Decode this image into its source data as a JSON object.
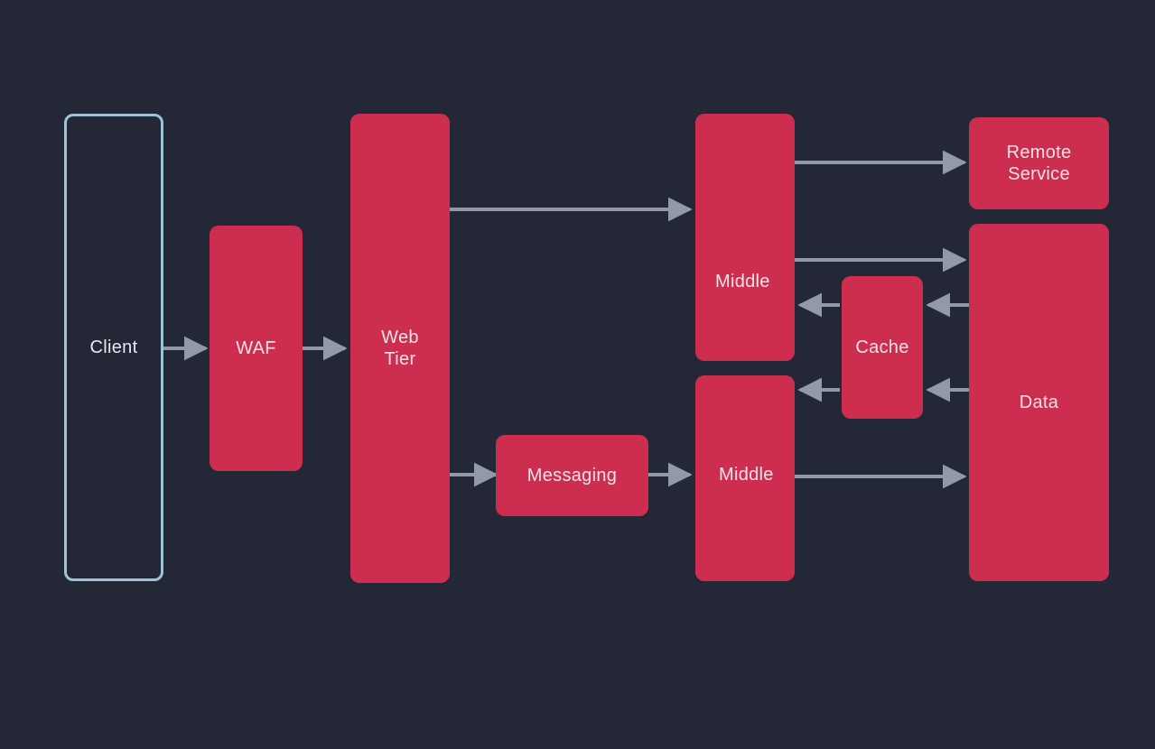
{
  "nodes": {
    "client": {
      "label": "Client"
    },
    "waf": {
      "label": "WAF"
    },
    "web_tier": {
      "label": "Web\nTier"
    },
    "messaging": {
      "label": "Messaging"
    },
    "middle_top": {
      "label": "Middle"
    },
    "middle_bottom": {
      "label": "Middle"
    },
    "cache": {
      "label": "Cache"
    },
    "remote": {
      "label": "Remote\nService"
    },
    "data": {
      "label": "Data"
    }
  },
  "colors": {
    "bg": "#242836",
    "node": "#cd2d4e",
    "outline": "#9bc4d6",
    "arrow": "#939aa7"
  },
  "edges": [
    {
      "from": "client",
      "to": "waf"
    },
    {
      "from": "waf",
      "to": "web_tier"
    },
    {
      "from": "web_tier",
      "to": "middle_top"
    },
    {
      "from": "web_tier",
      "to": "messaging"
    },
    {
      "from": "messaging",
      "to": "middle_bottom"
    },
    {
      "from": "middle_top",
      "to": "remote"
    },
    {
      "from": "middle_top",
      "to": "data"
    },
    {
      "from": "middle_bottom",
      "to": "data"
    },
    {
      "from": "cache",
      "to": "middle_top"
    },
    {
      "from": "cache",
      "to": "middle_bottom"
    },
    {
      "from": "data",
      "to": "cache",
      "note": "upper"
    },
    {
      "from": "data",
      "to": "cache",
      "note": "lower"
    }
  ]
}
